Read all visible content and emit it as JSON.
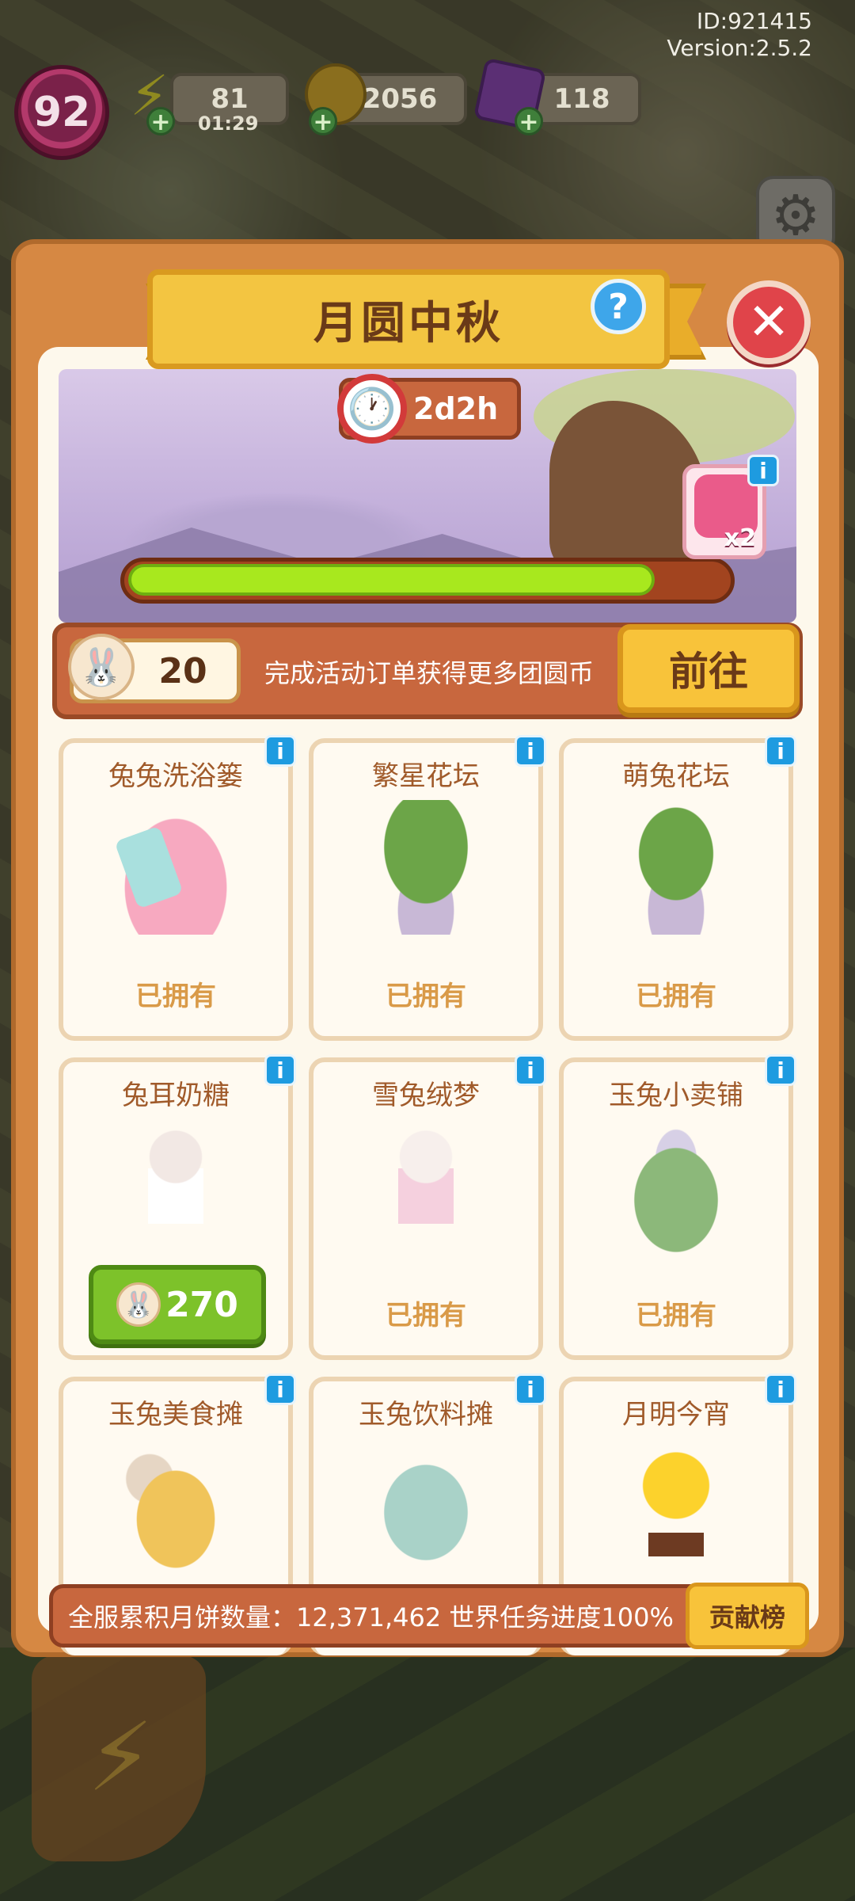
{
  "meta": {
    "id_text": "ID:921415",
    "version_text": "Version:2.5.2"
  },
  "hud": {
    "level": "92",
    "energy": "81",
    "energy_timer": "01:29",
    "coins": "2056",
    "gems": "118",
    "plus": "+"
  },
  "panel": {
    "title": "月圆中秋",
    "help": "?",
    "close": "✕",
    "countdown": "2d2h",
    "progress_fraction": 0.88,
    "reward_multiplier": "x2",
    "info": "i"
  },
  "coin_row": {
    "amount": "20",
    "description": "完成活动订单获得更多团圆币",
    "go_label": "前往"
  },
  "items": [
    {
      "name": "兔兔洗浴篓",
      "status": "已拥有",
      "art": "tub"
    },
    {
      "name": "繁星花坛",
      "status": "已拥有",
      "art": "planter"
    },
    {
      "name": "萌兔花坛",
      "status": "已拥有",
      "art": "planter2"
    },
    {
      "name": "兔耳奶糖",
      "price": "270",
      "art": "char"
    },
    {
      "name": "雪兔绒梦",
      "status": "已拥有",
      "art": "char-pink"
    },
    {
      "name": "玉兔小卖铺",
      "status": "已拥有",
      "art": "stall"
    },
    {
      "name": "玉兔美食摊",
      "art": "food"
    },
    {
      "name": "玉兔饮料摊",
      "art": "drink"
    },
    {
      "name": "月明今宵",
      "art": "moon"
    }
  ],
  "footer": {
    "text": "全服累积月饼数量：12,371,462  世界任务进度100%",
    "rank_label": "贡献榜"
  },
  "colors": {
    "panel": "#d68843",
    "accent_yellow": "#f8c33a",
    "progress_green": "#a8e81e",
    "info_blue": "#1e9be0"
  }
}
